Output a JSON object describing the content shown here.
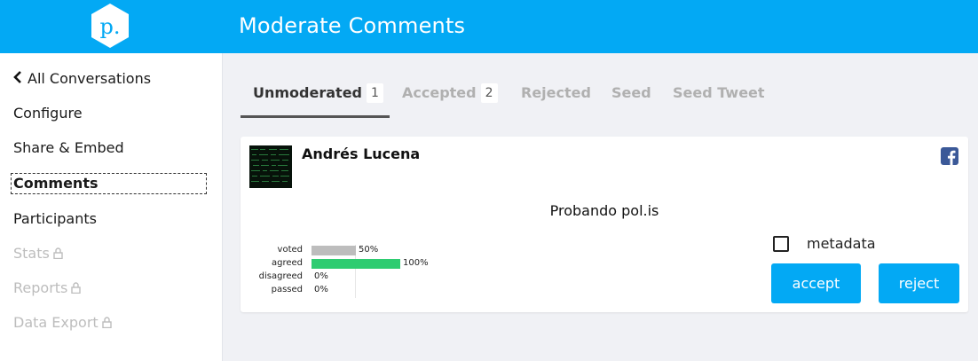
{
  "header": {
    "title": "Moderate Comments",
    "logo_letter": "p."
  },
  "sidebar": {
    "items": [
      {
        "label": "All Conversations",
        "state": "normal"
      },
      {
        "label": "Configure",
        "state": "normal"
      },
      {
        "label": "Share & Embed",
        "state": "normal"
      },
      {
        "label": "Comments",
        "state": "active"
      },
      {
        "label": "Participants",
        "state": "normal"
      },
      {
        "label": "Stats",
        "state": "locked"
      },
      {
        "label": "Reports",
        "state": "locked"
      },
      {
        "label": "Data Export",
        "state": "locked"
      }
    ]
  },
  "tabs": [
    {
      "label": "Unmoderated",
      "count": "1"
    },
    {
      "label": "Accepted",
      "count": "2"
    },
    {
      "label": "Rejected"
    },
    {
      "label": "Seed"
    },
    {
      "label": "Seed Tweet"
    }
  ],
  "comment": {
    "author": "Andrés Lucena",
    "text": "Probando pol.is",
    "stats": [
      {
        "label": "voted",
        "pct_label": "50%",
        "pct": 50,
        "color": "#bdbdbd"
      },
      {
        "label": "agreed",
        "pct_label": "100%",
        "pct": 100,
        "color": "#2ecc71"
      },
      {
        "label": "disagreed",
        "pct_label": "0%",
        "pct": 0,
        "color": "#e74c3c"
      },
      {
        "label": "passed",
        "pct_label": "0%",
        "pct": 0,
        "color": "#bdbdbd"
      }
    ],
    "metadata_label": "metadata",
    "accept_label": "accept",
    "reject_label": "reject"
  },
  "colors": {
    "brand": "#03a9f4",
    "agree": "#2ecc71",
    "facebook": "#3b5998"
  }
}
